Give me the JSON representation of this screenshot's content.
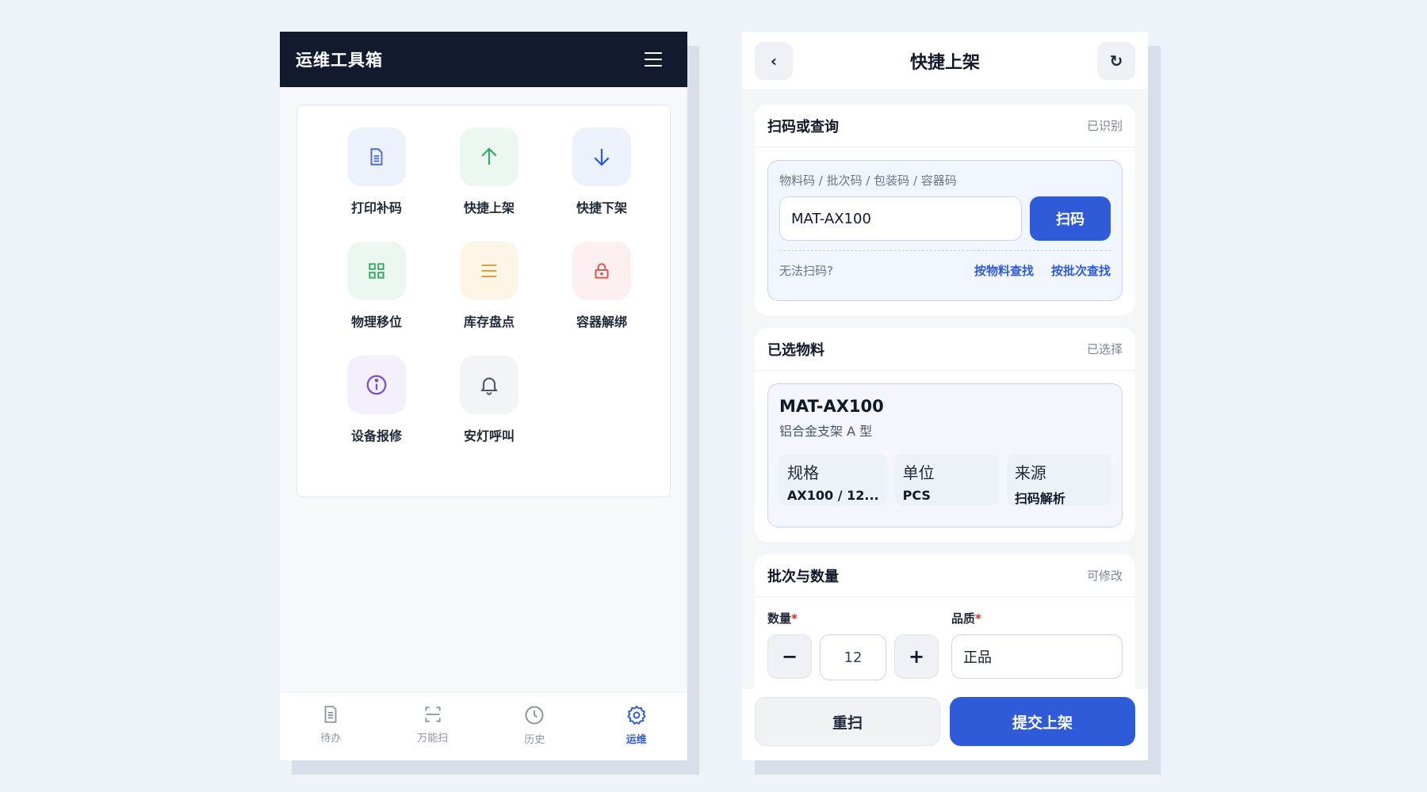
{
  "left": {
    "header": {
      "title": "运维工具箱"
    },
    "tools": [
      {
        "label": "打印补码",
        "icon": "document-icon",
        "bg": "#edf1fb",
        "color": "#4a6fd1"
      },
      {
        "label": "快捷上架",
        "icon": "arrow-up-icon",
        "bg": "#ebf7ef",
        "color": "#3aa86a"
      },
      {
        "label": "快捷下架",
        "icon": "arrow-down-icon",
        "bg": "#edf1fb",
        "color": "#2f5bd8"
      },
      {
        "label": "物理移位",
        "icon": "grid-icon",
        "bg": "#ebf7ef",
        "color": "#3aa86a"
      },
      {
        "label": "库存盘点",
        "icon": "list-icon",
        "bg": "#fdf6e6",
        "color": "#e0a030"
      },
      {
        "label": "容器解绑",
        "icon": "lock-icon",
        "bg": "#fcefef",
        "color": "#d9534f"
      },
      {
        "label": "设备报修",
        "icon": "info-icon",
        "bg": "#f3effb",
        "color": "#7a4fc9"
      },
      {
        "label": "安灯呼叫",
        "icon": "bell-icon",
        "bg": "#f3f4f7",
        "color": "#4b5563"
      }
    ],
    "nav": [
      {
        "label": "待办",
        "icon": "todo-icon"
      },
      {
        "label": "万能扫",
        "icon": "scan-icon"
      },
      {
        "label": "历史",
        "icon": "clock-icon"
      },
      {
        "label": "运维",
        "icon": "gear-icon"
      }
    ]
  },
  "right": {
    "header": {
      "title": "快捷上架",
      "back_icon": "‹",
      "refresh_icon": "↻"
    },
    "scan_section": {
      "title": "扫码或查询",
      "badge": "已识别",
      "hint": "物料码 / 批次码 / 包装码 / 容器码",
      "input_value": "MAT-AX100",
      "scan_button": "扫码",
      "cant_scan": "无法扫码?",
      "link_material": "按物料查找",
      "link_batch": "按批次查找"
    },
    "material_section": {
      "title": "已选物料",
      "badge": "已选择",
      "code": "MAT-AX100",
      "name": "铝合金支架 A 型",
      "attrs": [
        {
          "key": "规格",
          "value": "AX100 / 12..."
        },
        {
          "key": "单位",
          "value": "PCS"
        },
        {
          "key": "来源",
          "value": "扫码解析"
        }
      ]
    },
    "batch_section": {
      "title": "批次与数量",
      "badge": "可修改",
      "qty_label": "数量",
      "qty_value": "12",
      "minus": "−",
      "plus": "+",
      "quality_label": "品质",
      "quality_value": "正品",
      "required_mark": "*"
    },
    "actions": {
      "reset": "重扫",
      "submit": "提交上架"
    }
  }
}
